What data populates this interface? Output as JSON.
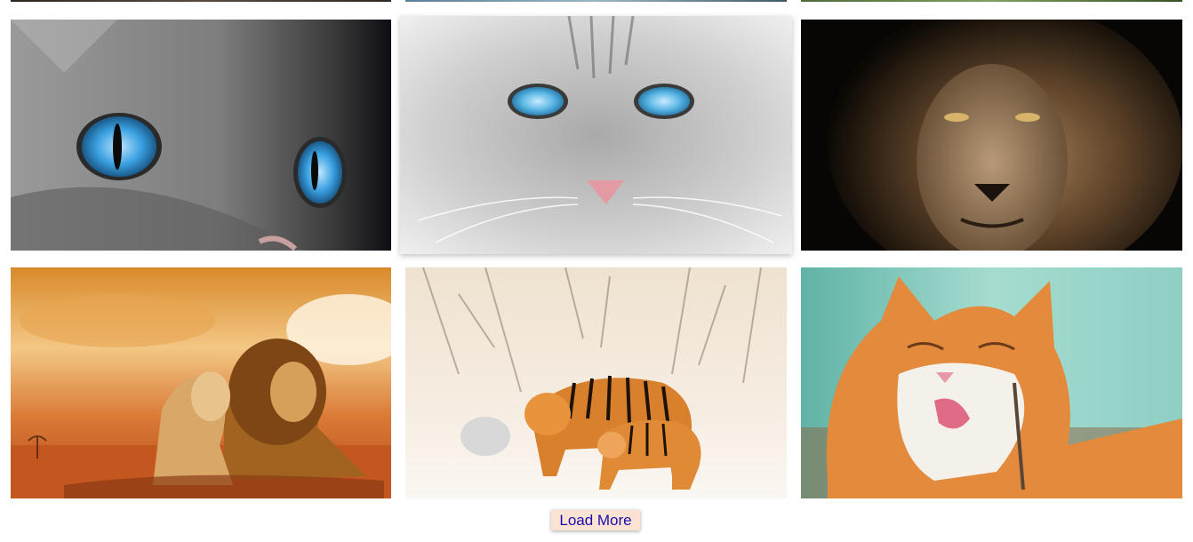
{
  "gallery": {
    "images": [
      {
        "subject": "cat-blue-eyes-closeup"
      },
      {
        "subject": "grey-tabby-cat-blue-eyes"
      },
      {
        "subject": "lion-face-dark"
      },
      {
        "subject": "lion-and-lioness-sunset"
      },
      {
        "subject": "tigers-in-snow"
      },
      {
        "subject": "orange-cat-licking"
      }
    ]
  },
  "load_more": {
    "label": "Load More",
    "background": "#fbe3d4",
    "text_color": "#1a0dab"
  }
}
